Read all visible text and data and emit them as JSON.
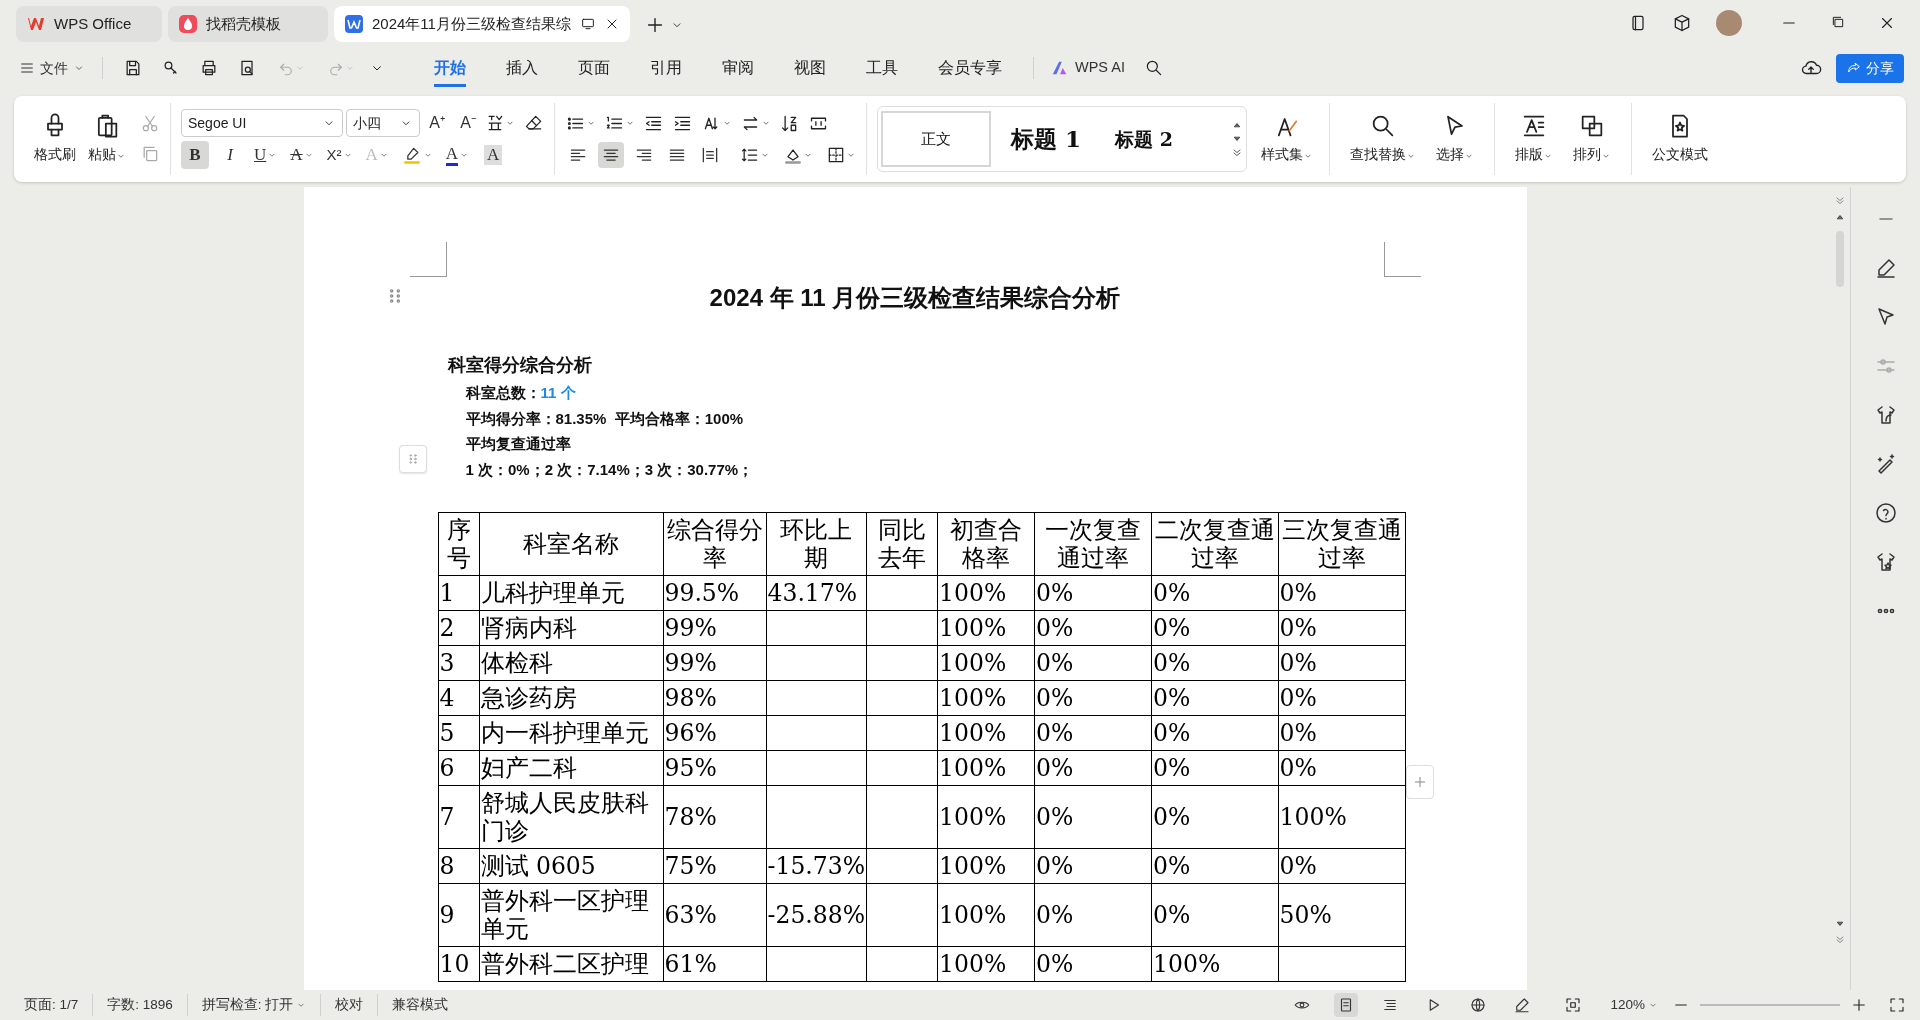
{
  "tabs": [
    {
      "label": "WPS Office",
      "kind": "wps",
      "selected": false
    },
    {
      "label": "找稻壳模板",
      "kind": "docer",
      "selected": false
    },
    {
      "label": "2024年11月份三级检查结果综",
      "kind": "writer",
      "selected": true
    }
  ],
  "menu": {
    "file": "文件",
    "tabs": [
      {
        "label": "开始",
        "selected": true
      },
      {
        "label": "插入",
        "selected": false
      },
      {
        "label": "页面",
        "selected": false
      },
      {
        "label": "引用",
        "selected": false
      },
      {
        "label": "审阅",
        "selected": false
      },
      {
        "label": "视图",
        "selected": false
      },
      {
        "label": "工具",
        "selected": false
      },
      {
        "label": "会员专享",
        "selected": false
      }
    ],
    "ai": "WPS AI",
    "share": "分享"
  },
  "ribbon": {
    "clipboard": [
      {
        "label": "格式刷",
        "kind": "painter",
        "dropdown": false
      },
      {
        "label": "粘贴",
        "kind": "paste",
        "dropdown": true
      }
    ],
    "font_name": "Segoe UI",
    "font_size": "小四",
    "size_buttons": [
      {
        "label": "A⁺"
      },
      {
        "label": "A⁻"
      }
    ],
    "format": [
      {
        "label": "B",
        "kind": "bold",
        "selected": true,
        "dropdown": false
      },
      {
        "label": "I",
        "kind": "italic",
        "selected": false,
        "dropdown": false
      },
      {
        "label": "U",
        "kind": "underline",
        "selected": false,
        "dropdown": true
      },
      {
        "label": "A",
        "kind": "strike",
        "selected": false,
        "dropdown": true
      },
      {
        "label": "X²",
        "kind": "superscript",
        "selected": false,
        "dropdown": true
      },
      {
        "label": "A",
        "kind": "effect",
        "selected": false,
        "dropdown": true
      },
      {
        "kind": "highlight",
        "selected": false,
        "dropdown": true
      },
      {
        "label": "A",
        "kind": "color",
        "selected": false,
        "dropdown": true
      },
      {
        "label": "A",
        "kind": "shade",
        "selected": false,
        "dropdown": false
      }
    ],
    "alignment": [
      {
        "kind": "left",
        "selected": false
      },
      {
        "kind": "center",
        "selected": true
      },
      {
        "kind": "right",
        "selected": false
      },
      {
        "kind": "justify",
        "selected": false
      },
      {
        "kind": "distributed",
        "selected": false
      }
    ],
    "styles": [
      {
        "label": "正文",
        "kind": "body",
        "selected": true
      },
      {
        "label": "标题 1",
        "kind": "h1",
        "selected": false
      },
      {
        "label": "标题 2",
        "kind": "h2",
        "selected": false
      }
    ],
    "style_set": "样式集",
    "tools": [
      {
        "label": "查找替换",
        "kind": "find",
        "dropdown": true
      },
      {
        "label": "选择",
        "kind": "select",
        "dropdown": true
      },
      {
        "label": "排版",
        "kind": "layout",
        "dropdown": true
      },
      {
        "label": "排列",
        "kind": "arrange",
        "dropdown": true
      },
      {
        "label": "公文模式",
        "kind": "official",
        "dropdown": false
      }
    ]
  },
  "document": {
    "title": "2024 年 11 月份三级检查结果综合分析",
    "section": "科室得分综合分析",
    "count_label": "科室总数：",
    "count_value": "11 个",
    "lines": [
      "平均得分率：81.35%  平均合格率：100%",
      "平均复查通过率",
      "1 次：0%；2 次：7.14%；3 次：30.77%；"
    ],
    "table": {
      "columns": [
        "序号",
        "科室名称",
        "综合得分率",
        "环比上期",
        "同比去年",
        "初查合格率",
        "一次复查通过率",
        "二次复查通过率",
        "三次复查通过率"
      ],
      "rows": [
        [
          "1",
          "儿科护理单元",
          "99.5%",
          "43.17%",
          null,
          "100%",
          "0%",
          "0%",
          "0%"
        ],
        [
          "2",
          "肾病内科",
          "99%",
          null,
          null,
          "100%",
          "0%",
          "0%",
          "0%"
        ],
        [
          "3",
          "体检科",
          "99%",
          null,
          null,
          "100%",
          "0%",
          "0%",
          "0%"
        ],
        [
          "4",
          "急诊药房",
          "98%",
          null,
          null,
          "100%",
          "0%",
          "0%",
          "0%"
        ],
        [
          "5",
          "内一科护理单元",
          "96%",
          null,
          null,
          "100%",
          "0%",
          "0%",
          "0%"
        ],
        [
          "6",
          "妇产二科",
          "95%",
          null,
          null,
          "100%",
          "0%",
          "0%",
          "0%"
        ],
        [
          "7",
          "舒城人民皮肤科门诊",
          "78%",
          null,
          null,
          "100%",
          "0%",
          "0%",
          "100%"
        ],
        [
          "8",
          "测试 0605",
          "75%",
          "-15.73%",
          null,
          "100%",
          "0%",
          "0%",
          "0%"
        ],
        [
          "9",
          "普外科一区护理单元",
          "63%",
          "-25.88%",
          null,
          "100%",
          "0%",
          "0%",
          "50%"
        ],
        [
          "10",
          "普外科二区护理",
          "61%",
          null,
          null,
          "100%",
          "0%",
          "100%",
          null
        ]
      ]
    }
  },
  "status": {
    "items": [
      {
        "label": "页面: 1/7",
        "dropdown": false
      },
      {
        "label": "字数: 1896",
        "dropdown": false
      },
      {
        "label": "拼写检查: 打开",
        "dropdown": true
      },
      {
        "label": "校对",
        "dropdown": false
      },
      {
        "label": "兼容模式",
        "dropdown": false
      }
    ],
    "views": [
      {
        "kind": "read",
        "selected": false
      },
      {
        "kind": "page",
        "selected": true
      },
      {
        "kind": "outline",
        "selected": false
      },
      {
        "kind": "play",
        "selected": false
      },
      {
        "kind": "web",
        "selected": false
      },
      {
        "kind": "pen",
        "selected": false
      }
    ],
    "zoom": "120%"
  }
}
